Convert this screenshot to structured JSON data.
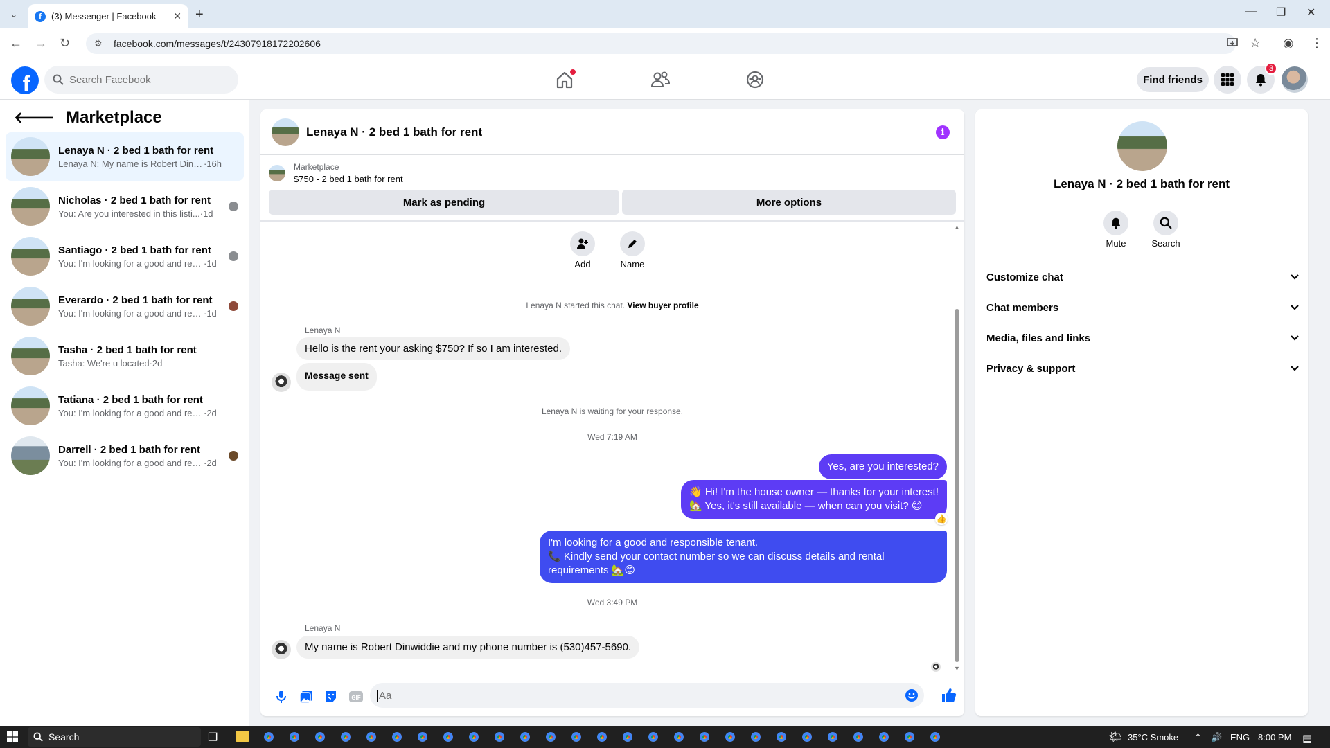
{
  "browser": {
    "tab_title": "(3) Messenger | Facebook",
    "url": "facebook.com/messages/t/24307918172202606"
  },
  "header": {
    "search_placeholder": "Search Facebook",
    "find_friends": "Find friends",
    "notification_count": "3"
  },
  "sidebar": {
    "title": "Marketplace",
    "conversations": [
      {
        "name": "Lenaya N · 2 bed 1 bath for rent",
        "preview": "Lenaya N: My name is Robert Dinwid...",
        "time": "·16h"
      },
      {
        "name": "Nicholas · 2 bed 1 bath for rent",
        "preview": "You: Are you interested in this listi...",
        "time": "·1d"
      },
      {
        "name": "Santiago · 2 bed 1 bath for rent",
        "preview": "You: I'm looking for a good and res...",
        "time": "·1d"
      },
      {
        "name": "Everardo · 2 bed 1 bath for rent",
        "preview": "You: I'm looking for a good and res...",
        "time": "·1d"
      },
      {
        "name": "Tasha · 2 bed 1 bath for rent",
        "preview": "Tasha: We're u located",
        "time": "·2d"
      },
      {
        "name": "Tatiana · 2 bed 1 bath for rent",
        "preview": "You: I'm looking for a good and respo...",
        "time": "·2d"
      },
      {
        "name": "Darrell · 2 bed 1 bath for rent",
        "preview": "You: I'm looking for a good and res...",
        "time": "·2d"
      }
    ]
  },
  "chat": {
    "title": "Lenaya N · 2 bed 1 bath for rent",
    "listing_source": "Marketplace",
    "listing_title": "$750 - 2 bed 1 bath for rent",
    "mark_pending": "Mark as pending",
    "more_options": "More options",
    "add_label": "Add",
    "name_label": "Name",
    "started_text": "Lenaya N started this chat.",
    "view_buyer": "View buyer profile",
    "sender_name": "Lenaya N",
    "msg1": "Hello is the rent your asking $750? If so I am interested.",
    "msg2": "Message sent",
    "waiting": "Lenaya N is waiting for your response.",
    "time1": "Wed 7:19 AM",
    "out1": "Yes, are you interested?",
    "out2_line1": "👋 Hi! I'm the house owner — thanks for your interest!",
    "out2_line2": "🏡 Yes, it's still available — when can you visit? 😊",
    "out3_line1": "I'm looking for a good and responsible tenant.",
    "out3_line2": "📞 Kindly send your contact number so we can discuss details and rental",
    "out3_line3": "requirements 🏡😊",
    "time2": "Wed 3:49 PM",
    "msg3": "My name is Robert Dinwiddie and my phone number is (530)457-5690.",
    "input_placeholder": "Aa"
  },
  "rightpanel": {
    "name": "Lenaya N · 2 bed 1 bath for rent",
    "mute": "Mute",
    "search": "Search",
    "rows": [
      "Customize chat",
      "Chat members",
      "Media, files and links",
      "Privacy & support"
    ]
  },
  "taskbar": {
    "search": "Search",
    "weather": "35°C  Smoke",
    "lang": "ENG",
    "time": "8:00 PM"
  },
  "colors": {
    "fb_blue": "#0866ff",
    "outgoing_bubble": "#5d3cf5",
    "badge_red": "#e41e3f"
  }
}
